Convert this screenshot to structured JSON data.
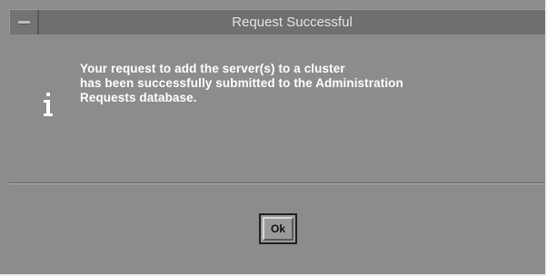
{
  "window": {
    "title": "Request Successful",
    "menu_icon": "window-menu-icon"
  },
  "message": {
    "icon": "info-icon",
    "lines": [
      "Your request to add the server(s) to a cluster",
      "has been successfully submitted to the Administration",
      "Requests database."
    ]
  },
  "buttons": {
    "ok_label": "Ok"
  },
  "colors": {
    "dialog_background": "#8c8c8c",
    "titlebar": "#6f6f6f",
    "text": "#ffffff"
  }
}
